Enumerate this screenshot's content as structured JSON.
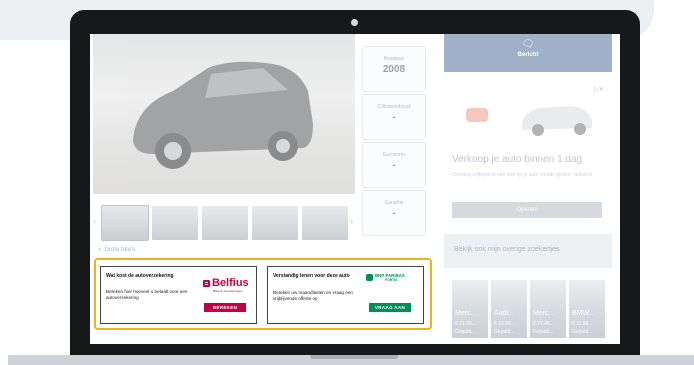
{
  "specs": [
    {
      "label": "Bouwjaar",
      "value": "2008"
    },
    {
      "label": "Cilinderinhoud",
      "value": "-"
    },
    {
      "label": "Euronorm",
      "value": "-"
    },
    {
      "label": "Garantie",
      "value": "-"
    }
  ],
  "gallery": {
    "prev": "‹",
    "next": "›",
    "big_photos": "Grote foto's"
  },
  "sidebar": {
    "message_label": "Bericht",
    "ad_close": "▷✕",
    "ad_title": "Verkoop je auto binnen 1 dag",
    "ad_body": "Ontvang vrijblijvend een bod op je auto zonder gedoe, verkocht.",
    "ad_button": "Openen",
    "own_listings": "Bekijk ook mijn overige zoekertjes",
    "cards": [
      {
        "name": "Merc...",
        "price": "€ 21.99...",
        "date": "Gepubl..."
      },
      {
        "name": "Audi...",
        "price": "€ 19.99...",
        "date": "Gepubl..."
      },
      {
        "name": "Merc...",
        "price": "€ 17.45...",
        "date": "Gepubl..."
      },
      {
        "name": "BMW...",
        "price": "€ 11.99...",
        "date": "Gepubl..."
      }
    ]
  },
  "offers": {
    "insurance": {
      "heading": "Wat kost de autoverzekering",
      "body": "Bereken hier hoeveel u betaalt voor een autoverzekering",
      "brand": "Belfius",
      "brand_tag": "Bank & Verzekeringen",
      "button": "BEREKEN",
      "button_color": "#c30045"
    },
    "loan": {
      "heading": "Verstandig lenen voor deze auto",
      "body": "Bereken uw maandlasten en vraag een vrijblijvende offerte op",
      "brand_line1": "BNP PARIBAS",
      "brand_line2": "FORTIS",
      "button": "VRAAG AAN",
      "button_color": "#00915a"
    },
    "highlight_color": "#f3b01e"
  }
}
